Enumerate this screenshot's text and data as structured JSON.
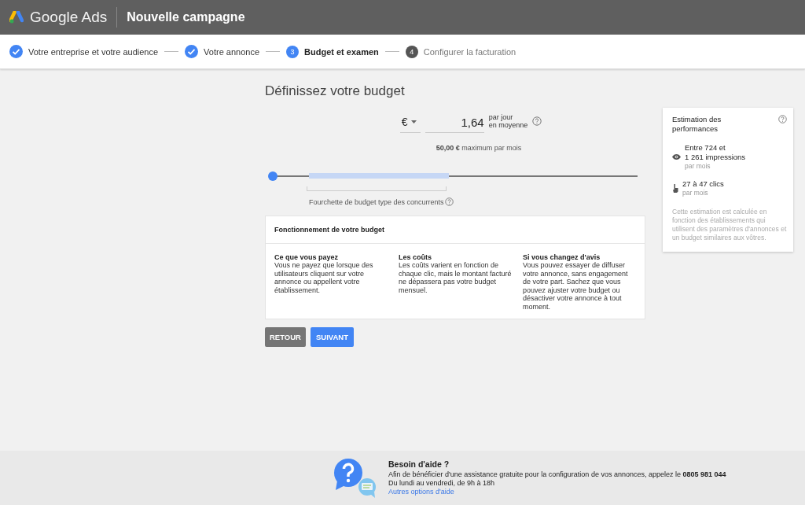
{
  "header": {
    "product": "Google Ads",
    "title": "Nouvelle campagne"
  },
  "steps": [
    {
      "label": "Votre entreprise et votre audience",
      "completed": true,
      "selected": false
    },
    {
      "label": "Votre annonce",
      "completed": true,
      "selected": false
    },
    {
      "label": "Budget et examen",
      "number": "3",
      "completed": false,
      "selected": true
    },
    {
      "label": "Configurer la facturation",
      "number": "4",
      "completed": false,
      "selected": false
    }
  ],
  "budget": {
    "title": "Définissez votre budget",
    "currency": "€",
    "amount": "1,64",
    "unit_line1": "par jour",
    "unit_line2": "en moyenne",
    "monthly_amount": "50,00 €",
    "monthly_label": "maximum par mois",
    "slider": {
      "level": 0
    },
    "range_label": "Fourchette de budget type des concurrents"
  },
  "how_it_works": {
    "title": "Fonctionnement de votre budget",
    "columns": [
      {
        "heading": "Ce que vous payez",
        "text": "Vous ne payez que lorsque des utilisateurs cliquent sur votre annonce ou appellent votre établissement."
      },
      {
        "heading": "Les coûts",
        "text": "Les coûts varient en fonction de chaque clic, mais le montant facturé ne dépassera pas votre budget mensuel."
      },
      {
        "heading": "Si vous changez d'avis",
        "text": "Vous pouvez essayer de diffuser votre annonce, sans engagement de votre part. Sachez que vous pouvez ajuster votre budget ou désactiver votre annonce à tout moment."
      }
    ]
  },
  "buttons": [
    {
      "label": "RETOUR",
      "kind": "secondary"
    },
    {
      "label": "SUIVANT",
      "kind": "primary"
    }
  ],
  "estimate": {
    "title": "Estimation des performances",
    "metrics": [
      {
        "kind": "impressions",
        "value_line1": "Entre 724 et",
        "value_line2": "1 261 impressions",
        "period": "par mois"
      },
      {
        "kind": "clicks",
        "value_line1": "27 à 47 clics",
        "period": "par mois"
      }
    ],
    "note": "Cette estimation est calculée en fonction des établissements qui utilisent des paramètres d'annonces et un budget similaires aux vôtres."
  },
  "help": {
    "title": "Besoin d'aide ?",
    "text": "Afin de bénéficier d'une assistance gratuite pour la configuration de vos annonces, appelez le **0805 981 044**",
    "hours": "Du lundi au vendredi, de 9h à 18h",
    "link": "Autres options d'aide"
  }
}
